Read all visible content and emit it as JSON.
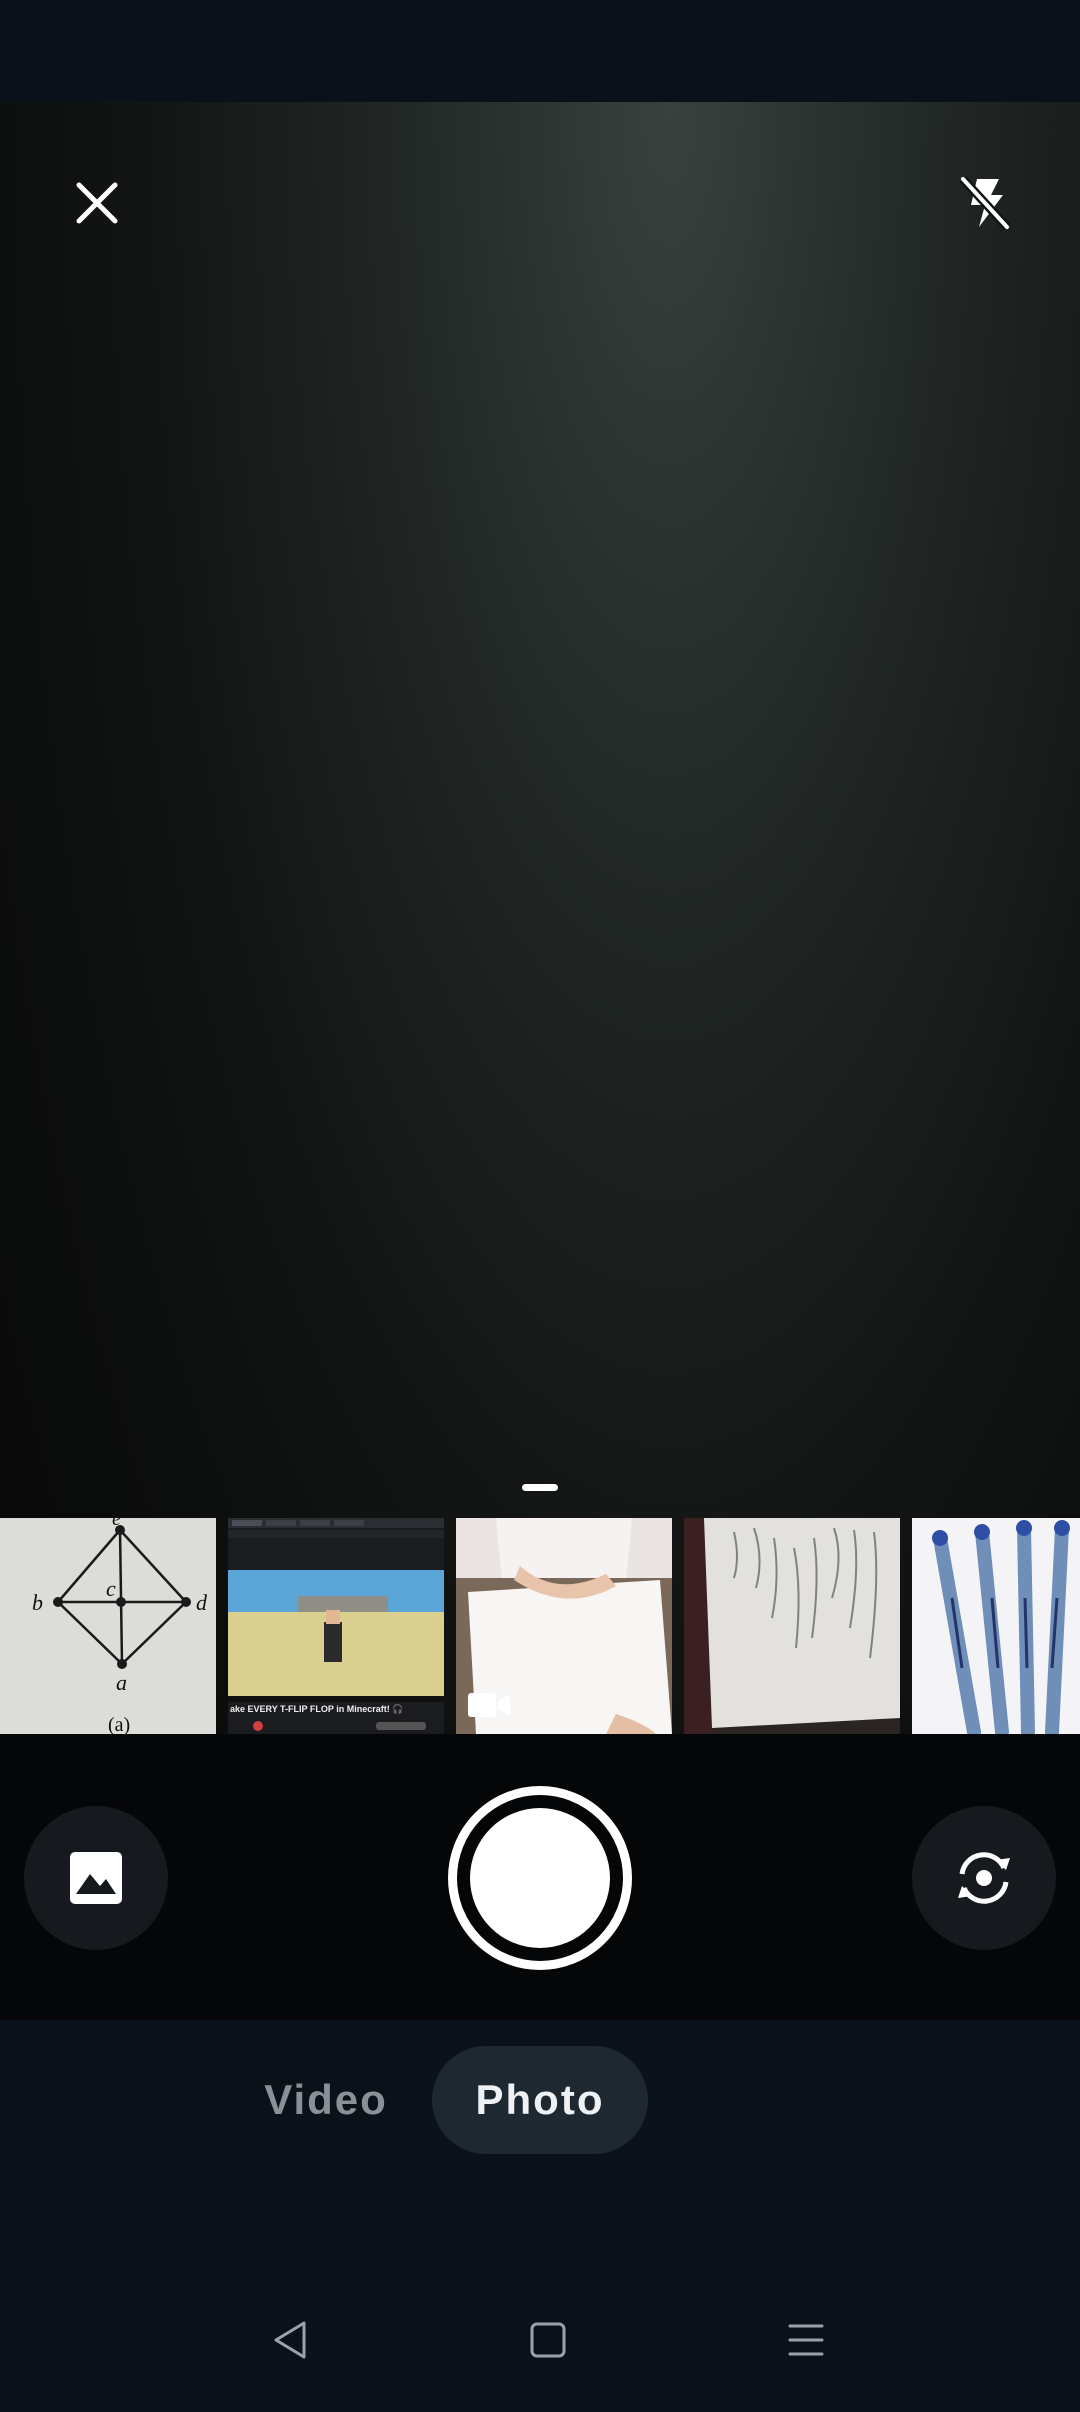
{
  "toolbar": {
    "close_icon": "close-icon",
    "flash_icon": "flash-off-icon"
  },
  "recent_media": [
    {
      "kind": "photo",
      "description_icon": "graph-diagram-photo",
      "graph_labels": [
        "e",
        "b",
        "c",
        "d",
        "a",
        "(a)"
      ]
    },
    {
      "kind": "photo",
      "description_icon": "screenshot-photo",
      "caption": "ake EVERY T-FLIP FLOP in Minecraft! 🎧"
    },
    {
      "kind": "video",
      "description_icon": "video-camera-icon"
    },
    {
      "kind": "photo",
      "description_icon": "handwritten-notes-photo"
    },
    {
      "kind": "photo",
      "description_icon": "pens-photo"
    }
  ],
  "controls": {
    "gallery_icon": "image-icon",
    "shutter_icon": "shutter-button",
    "flip_icon": "flip-camera-icon"
  },
  "modes": {
    "video_label": "Video",
    "photo_label": "Photo",
    "selected": "Photo"
  },
  "colors": {
    "background": "#0b1119",
    "selected_mode_bg": "#1e2830",
    "shutter": "#ffffff"
  }
}
